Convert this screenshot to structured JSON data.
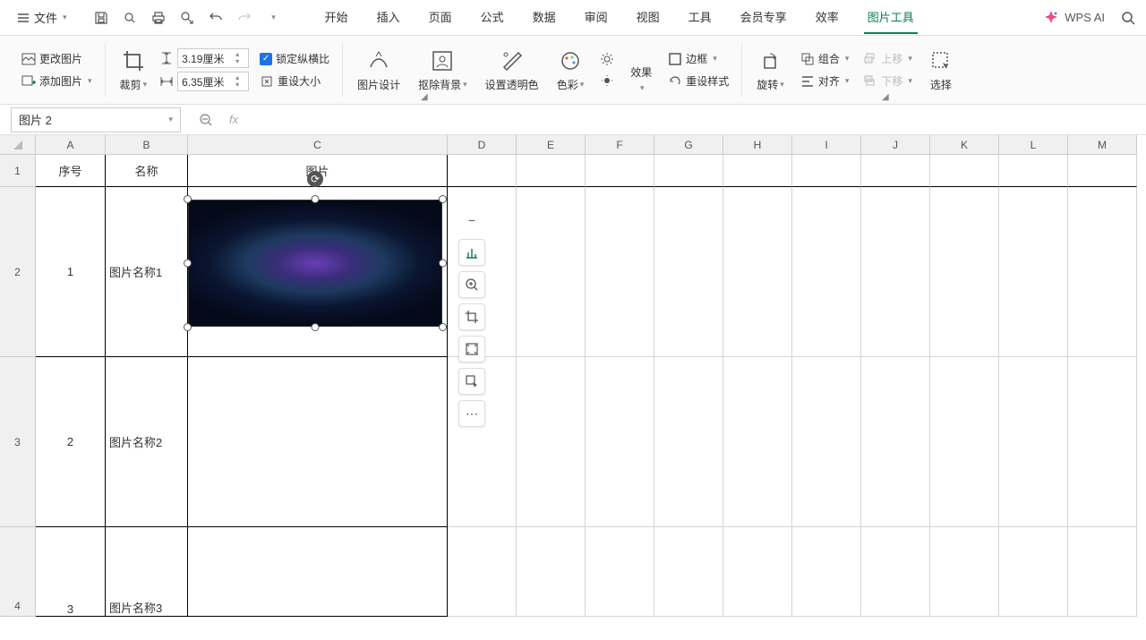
{
  "menu": {
    "file_label": "文件",
    "tabs": [
      "开始",
      "插入",
      "页面",
      "公式",
      "数据",
      "审阅",
      "视图",
      "工具",
      "会员专享",
      "效率",
      "图片工具"
    ],
    "active_tab": "图片工具",
    "wps_ai": "WPS AI"
  },
  "ribbon": {
    "change_pic": "更改图片",
    "add_pic": "添加图片",
    "crop": "裁剪",
    "height_value": "3.19厘米",
    "width_value": "6.35厘米",
    "lock_ratio": "锁定纵横比",
    "reset_size": "重设大小",
    "pic_design": "图片设计",
    "remove_bg": "抠除背景",
    "set_transparent": "设置透明色",
    "color": "色彩",
    "effect": "效果",
    "reset_style": "重设样式",
    "border": "边框",
    "rotate": "旋转",
    "group": "组合",
    "align": "对齐",
    "move_up": "上移",
    "move_down": "下移",
    "select": "选择"
  },
  "name_box": "图片 2",
  "columns": [
    "A",
    "B",
    "C",
    "D",
    "E",
    "F",
    "G",
    "H",
    "I",
    "J",
    "K",
    "L",
    "M"
  ],
  "headers": {
    "A": "序号",
    "B": "名称",
    "C": "图片"
  },
  "rows_data": [
    {
      "num": "1",
      "name": "图片名称1"
    },
    {
      "num": "2",
      "name": "图片名称2"
    },
    {
      "num": "3",
      "name": "图片名称3"
    }
  ]
}
